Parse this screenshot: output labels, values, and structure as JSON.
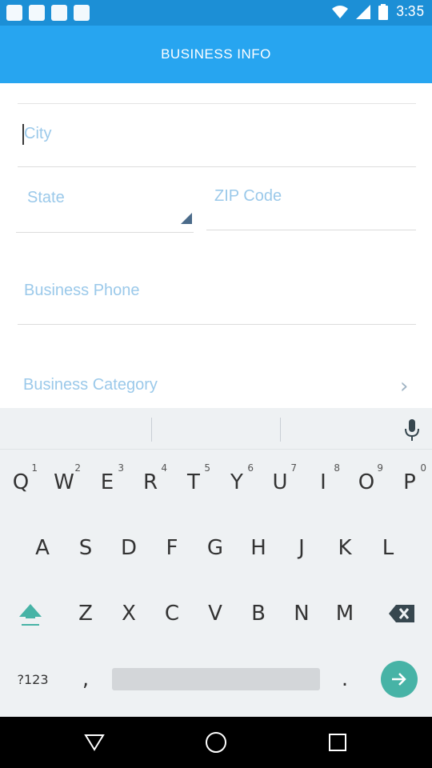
{
  "status_bar": {
    "time": "3:35",
    "left_icons": [
      "notification-icon",
      "notification-icon",
      "notification-icon",
      "notification-icon"
    ],
    "right_icons": [
      "wifi-icon",
      "signal-icon",
      "battery-icon"
    ]
  },
  "app_bar": {
    "title": "BUSINESS INFO"
  },
  "form": {
    "city_placeholder": "City",
    "state_placeholder": "State",
    "zip_placeholder": "ZIP Code",
    "phone_placeholder": "Business Phone",
    "category_placeholder": "Business Category"
  },
  "keyboard": {
    "row1": [
      {
        "label": "Q",
        "hint": "1"
      },
      {
        "label": "W",
        "hint": "2"
      },
      {
        "label": "E",
        "hint": "3"
      },
      {
        "label": "R",
        "hint": "4"
      },
      {
        "label": "T",
        "hint": "5"
      },
      {
        "label": "Y",
        "hint": "6"
      },
      {
        "label": "U",
        "hint": "7"
      },
      {
        "label": "I",
        "hint": "8"
      },
      {
        "label": "O",
        "hint": "9"
      },
      {
        "label": "P",
        "hint": "0"
      }
    ],
    "row2": [
      "A",
      "S",
      "D",
      "F",
      "G",
      "H",
      "J",
      "K",
      "L"
    ],
    "row3": [
      "Z",
      "X",
      "C",
      "V",
      "B",
      "N",
      "M"
    ],
    "symbols_label": "?123",
    "comma_label": ",",
    "period_label": ".",
    "accent_color": "#47b3a6"
  },
  "nav_bar": {
    "buttons": [
      "back-icon",
      "home-icon",
      "recents-icon"
    ]
  },
  "colors": {
    "status_bar": "#1c8fd6",
    "app_bar": "#27a5f0",
    "placeholder": "#9bc9ea"
  }
}
